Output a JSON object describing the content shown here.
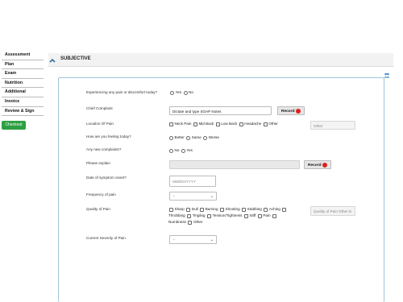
{
  "sidebar": {
    "items": [
      "Assessment",
      "Plan",
      "Exam",
      "Nutrition",
      "Additional",
      "Invoice",
      "Review & Sign"
    ],
    "checkout_label": "Checkout"
  },
  "section": {
    "title": "SUBJECTIVE"
  },
  "form": {
    "pain_discomfort": {
      "label": "Experiencing any pain or discomfort today?",
      "options": [
        "Yes",
        "No"
      ]
    },
    "chief_complaint": {
      "label": "Chief Complaint",
      "placeholder": "Dictate and type SOAP Notes",
      "record_label": "Record"
    },
    "location_of_pain": {
      "label": "Location Of Pain",
      "options": [
        "Neck Pain",
        "Mid Back",
        "Low Back",
        "Headache",
        "Other"
      ],
      "other_placeholder": "Other"
    },
    "feeling_today": {
      "label": "How are you feeling today?",
      "options": [
        "Better",
        "Same",
        "Worse"
      ]
    },
    "new_complaints": {
      "label": "Any new complaints?",
      "options": [
        "No",
        "Yes"
      ]
    },
    "please_explain": {
      "label": "Please explain",
      "record_label": "Record"
    },
    "symptom_onset": {
      "label": "Date of symptom onset?",
      "placeholder": "MM/DD/YYYY"
    },
    "frequency": {
      "label": "Frequency of pain",
      "value": "-"
    },
    "quality": {
      "label": "Quality of Pain",
      "options": [
        "Sharp",
        "Dull",
        "Burning",
        "Shooting",
        "Stabbing",
        "Aching",
        "Throbbing",
        "Tingling",
        "Tension/Tightness",
        "Stiff",
        "Pain",
        "Numbness",
        "Other"
      ],
      "other_placeholder": "Quality of Pain Other D"
    },
    "severity": {
      "label": "Current Severity of Pain",
      "value": "-"
    }
  }
}
